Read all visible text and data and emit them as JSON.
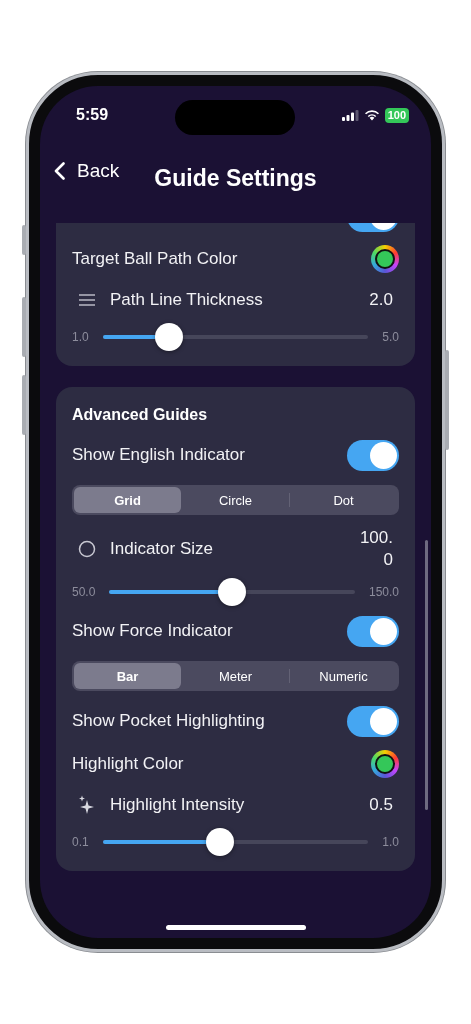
{
  "status_bar": {
    "time": "5:59",
    "battery": "100"
  },
  "nav": {
    "back": "Back",
    "title": "Guide Settings"
  },
  "sections": [
    {
      "rows": [
        {
          "kind": "toggle",
          "on": true
        },
        {
          "kind": "color",
          "label": "Target Ball Path Color",
          "color": "#34c759"
        },
        {
          "kind": "slider",
          "label": "Path Line Thickness",
          "value": "2.0",
          "min": "1.0",
          "max": "5.0",
          "level": 0.25
        }
      ]
    },
    {
      "title": "Advanced Guides",
      "rows": [
        {
          "kind": "toggle",
          "label": "Show English Indicator",
          "on": true
        },
        {
          "kind": "segmented",
          "options": [
            {
              "label": "Grid",
              "selected": true
            },
            {
              "label": "Circle",
              "selected": false
            },
            {
              "label": "Dot",
              "selected": false
            }
          ]
        },
        {
          "kind": "slider",
          "label": "Indicator Size",
          "value": "100.0",
          "min": "50.0",
          "max": "150.0",
          "level": 0.5
        },
        {
          "kind": "toggle",
          "label": "Show Force Indicator",
          "on": true
        },
        {
          "kind": "segmented",
          "options": [
            {
              "label": "Bar",
              "selected": true
            },
            {
              "label": "Meter",
              "selected": false
            },
            {
              "label": "Numeric",
              "selected": false
            }
          ]
        },
        {
          "kind": "toggle",
          "label": "Show Pocket Highlighting",
          "on": true
        },
        {
          "kind": "color",
          "label": "Highlight Color",
          "color": "#34c759"
        },
        {
          "kind": "slider",
          "label": "Highlight Intensity",
          "value": "0.5",
          "min": "0.1",
          "max": "1.0",
          "level": 0.44
        }
      ]
    }
  ]
}
